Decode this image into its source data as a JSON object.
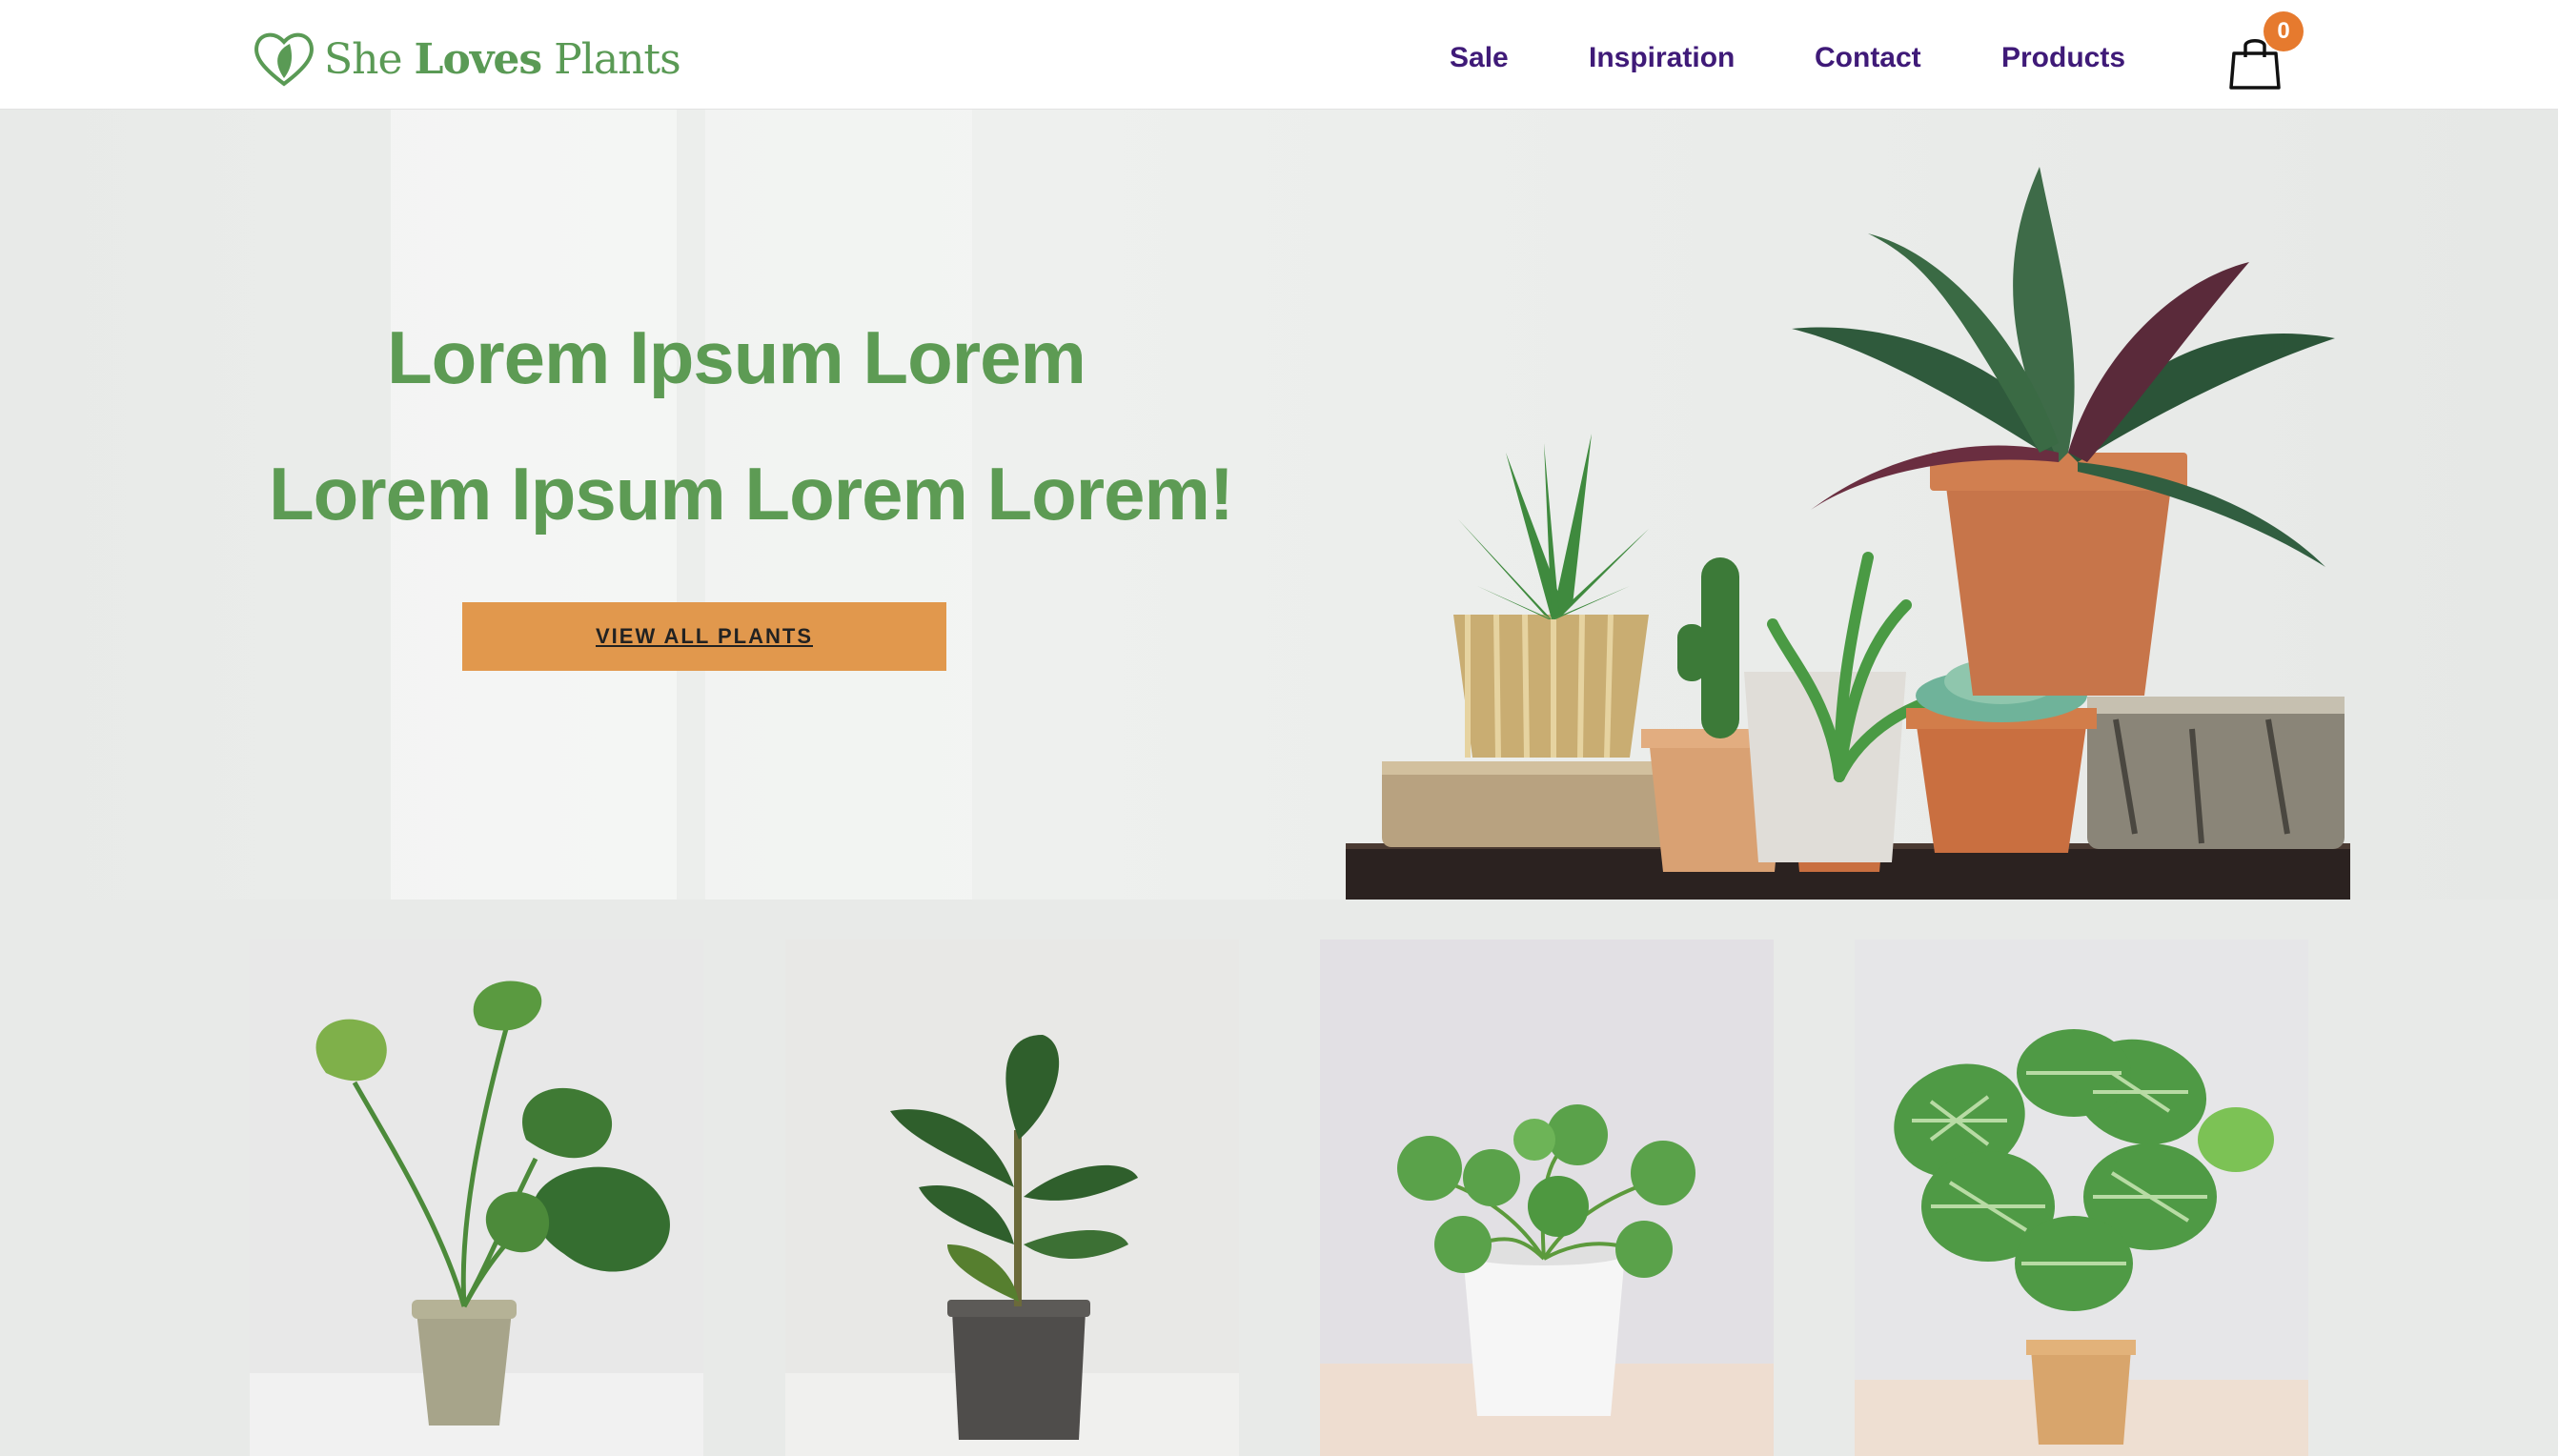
{
  "brand": {
    "name_part1": "She",
    "name_part2": "Loves",
    "name_part3": "Plants",
    "color": "#5a9a55"
  },
  "nav": {
    "items": [
      {
        "label": "Sale"
      },
      {
        "label": "Inspiration"
      },
      {
        "label": "Contact"
      },
      {
        "label": "Products"
      }
    ],
    "color": "#3f1a78"
  },
  "cart": {
    "count": "0",
    "badge_color": "#e67a2e"
  },
  "hero": {
    "title_line1": "Lorem Ipsum Lorem",
    "title_line2": "Lorem Ipsum Lorem Lorem!",
    "cta_label": "VIEW ALL PLANTS",
    "title_color": "#5d9b54",
    "cta_color": "#e1984d"
  },
  "products": [
    {
      "plant": "monstera-plant"
    },
    {
      "plant": "fiddle-leaf-fig-plant"
    },
    {
      "plant": "pilea-plant"
    },
    {
      "plant": "calathea-plant"
    }
  ]
}
